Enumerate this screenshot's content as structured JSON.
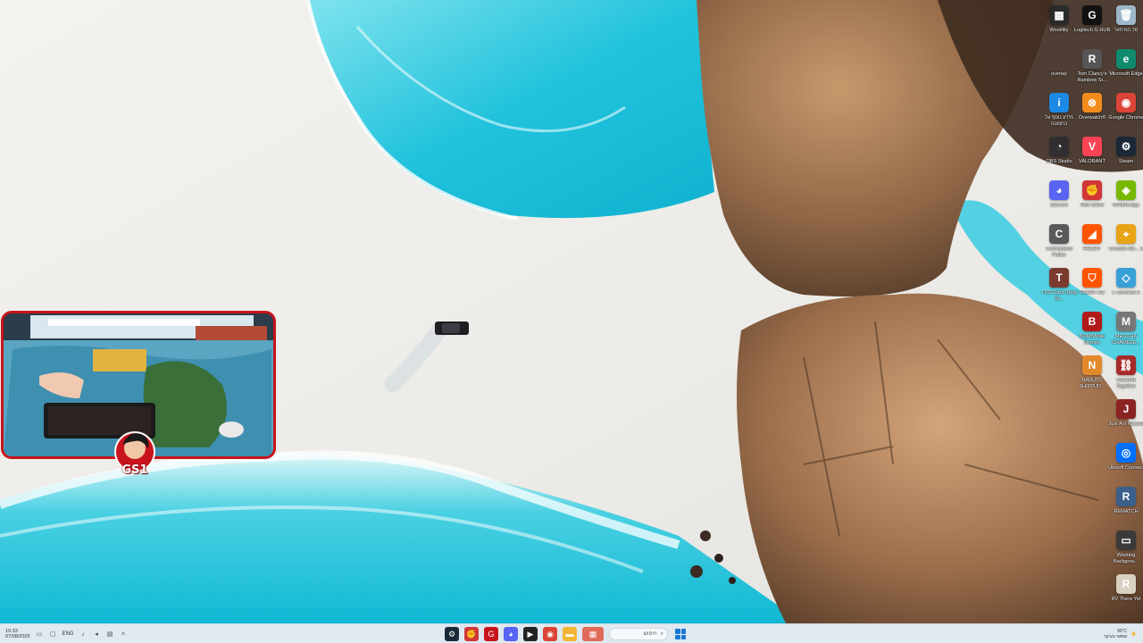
{
  "desktop": {
    "icons": [
      {
        "label": "Wootility",
        "color": "#2a2a2a",
        "glyph": "▦",
        "icon": "wootility-icon"
      },
      {
        "label": "Logitech G HUB",
        "color": "#111111",
        "glyph": "G",
        "icon": "logitech-g-icon"
      },
      {
        "label": "סל המיחזור",
        "color": "#9bb7c9",
        "glyph": "🗑",
        "icon": "recycle-bin-icon"
      },
      {
        "label": "overlay",
        "color": "transparent",
        "glyph": "",
        "icon": "overlay-icon"
      },
      {
        "label": "Tom Clancy's Rainbow Si...",
        "color": "#555555",
        "glyph": "R",
        "icon": "rainbow-six-icon"
      },
      {
        "label": "Microsoft Edge",
        "color": "#0f8a6d",
        "glyph": "e",
        "icon": "edge-icon"
      },
      {
        "label": "מידע נוסף על התמונה",
        "color": "#1e88e5",
        "glyph": "i",
        "icon": "info-picture-icon"
      },
      {
        "label": "Overwatch®",
        "color": "#f28c1c",
        "glyph": "⊗",
        "icon": "overwatch-icon"
      },
      {
        "label": "Google Chrome",
        "color": "#db4437",
        "glyph": "◉",
        "icon": "chrome-icon"
      },
      {
        "label": "OBS Studio",
        "color": "#302e31",
        "glyph": "◔",
        "icon": "obs-icon"
      },
      {
        "label": "VALORANT",
        "color": "#fa4454",
        "glyph": "V",
        "icon": "valorant-icon"
      },
      {
        "label": "Steam",
        "color": "#1b2838",
        "glyph": "⚙",
        "icon": "steam-icon"
      },
      {
        "label": "Discord",
        "color": "#5865f2",
        "glyph": "◕",
        "icon": "discord-icon"
      },
      {
        "label": "Riot Client",
        "color": "#d13639",
        "glyph": "✊",
        "icon": "riot-client-icon"
      },
      {
        "label": "NVIDIA App",
        "color": "#76b900",
        "glyph": "◈",
        "icon": "nvidia-icon"
      },
      {
        "label": "Contraband Police",
        "color": "#5a5a5a",
        "glyph": "C",
        "icon": "contraband-police-icon"
      },
      {
        "label": "FACEIT",
        "color": "#ff5500",
        "glyph": "◢",
        "icon": "faceit-icon"
      },
      {
        "label": "Counter-Str... 2",
        "color": "#e8a317",
        "glyph": "⌖",
        "icon": "counter-strike-icon"
      },
      {
        "label": "TCG Card Shop Si...",
        "color": "#7a3b2e",
        "glyph": "T",
        "icon": "tcg-card-shop-icon"
      },
      {
        "label": "FACEIT AC",
        "color": "#ff5500",
        "glyph": "⛉",
        "icon": "faceit-ac-icon"
      },
      {
        "label": "L-Connect 3",
        "color": "#3aa0d8",
        "glyph": "◇",
        "icon": "l-connect-icon"
      },
      {
        "label": "BOMBANie Demon",
        "color": "#b31b1b",
        "glyph": "B",
        "icon": "bombanie-icon"
      },
      {
        "label": "MECCHA CHAMELE...",
        "color": "#777777",
        "glyph": "M",
        "icon": "meccha-chameleon-icon"
      },
      {
        "label": "NARUTO SHIPPUD...",
        "color": "#e2892b",
        "glyph": "N",
        "icon": "naruto-icon"
      },
      {
        "label": "Chained Together",
        "color": "#a72a2a",
        "glyph": "⛓",
        "icon": "chained-together-icon"
      },
      {
        "label": "Just Act Natural",
        "color": "#8b2323",
        "glyph": "J",
        "icon": "just-act-natural-icon"
      },
      {
        "label": "Ubisoft Connect",
        "color": "#0070ff",
        "glyph": "◎",
        "icon": "ubisoft-connect-icon"
      },
      {
        "label": "REMATCH",
        "color": "#3a5f8a",
        "glyph": "R",
        "icon": "rematch-icon"
      },
      {
        "label": "Wooting Backgrou...",
        "color": "#3a3a3a",
        "glyph": "▭",
        "icon": "wooting-background-icon"
      },
      {
        "label": "RV There Yet",
        "color": "#d9d0c0",
        "glyph": "R",
        "icon": "rv-there-yet-icon"
      }
    ]
  },
  "overlay": {
    "logo_text": "GS1"
  },
  "taskbar": {
    "time": "19:33",
    "date": "07/08/2026",
    "language": "ENG",
    "search_placeholder": "חיפוש",
    "weather_temp": "30°C",
    "weather_desc": "שמשי בעיקר",
    "apps": [
      {
        "name": "steam-taskbar-icon",
        "color": "#1b2838",
        "glyph": "⚙"
      },
      {
        "name": "riot-taskbar-icon",
        "color": "#d13639",
        "glyph": "✊"
      },
      {
        "name": "logitech-taskbar-icon",
        "color": "#c8141c",
        "glyph": "G"
      },
      {
        "name": "discord-taskbar-icon",
        "color": "#5865f2",
        "glyph": "◕"
      },
      {
        "name": "terminal-taskbar-icon",
        "color": "#222222",
        "glyph": "▶"
      },
      {
        "name": "chrome-taskbar-icon",
        "color": "#db4437",
        "glyph": "◉"
      },
      {
        "name": "file-explorer-taskbar-icon",
        "color": "#f2b533",
        "glyph": "▬"
      },
      {
        "name": "game-bar-taskbar-icon",
        "color": "#e06a5a",
        "glyph": "▦"
      }
    ]
  }
}
